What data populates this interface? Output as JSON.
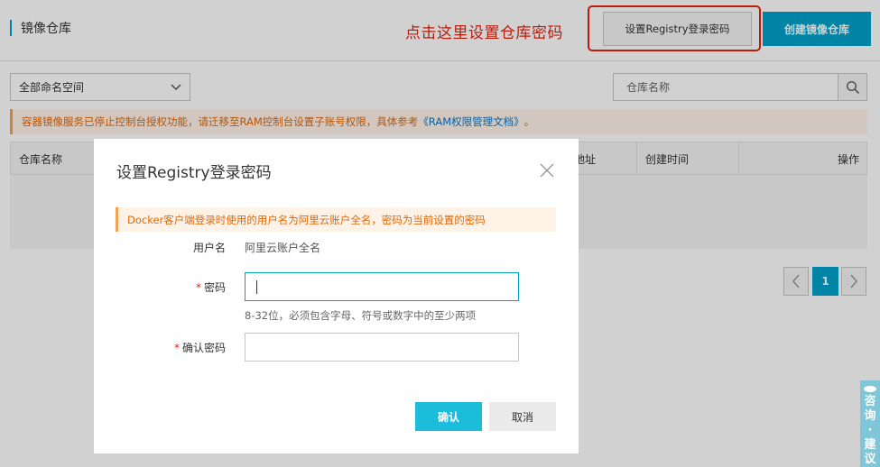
{
  "header": {
    "title": "镜像仓库",
    "annotation": "点击这里设置仓库密码",
    "registry_button": "设置Registry登录密码",
    "create_button": "创建镜像仓库"
  },
  "toolbar": {
    "namespace_select": "全部命名空间",
    "repo_search_placeholder": "仓库名称"
  },
  "notice": {
    "text": "容器镜像服务已停止控制台授权功能，请迁移至RAM控制台设置子账号权限，具体参考",
    "link": "《RAM权限管理文档》",
    "suffix": "。"
  },
  "table": {
    "columns": [
      "仓库名称",
      "地址",
      "创建时间",
      "操作"
    ]
  },
  "pagination": {
    "current_page": "1"
  },
  "modal": {
    "title": "设置Registry登录密码",
    "tip": "Docker客户端登录时使用的用户名为阿里云账户全名，密码为当前设置的密码",
    "username_label": "用户名",
    "username_value": "阿里云账户全名",
    "required_mark": "*",
    "password_label": "密码",
    "password_hint": "8-32位，必须包含字母、符号或数字中的至少两项",
    "confirm_label": "确认密码",
    "ok_button": "确认",
    "cancel_button": "取消"
  },
  "side_widget": {
    "chars": [
      "咨",
      "询",
      "·",
      "建",
      "议"
    ]
  },
  "colors": {
    "accent": "#00a2ca",
    "annotation": "#e5230f",
    "notice_text": "#e0680b"
  }
}
